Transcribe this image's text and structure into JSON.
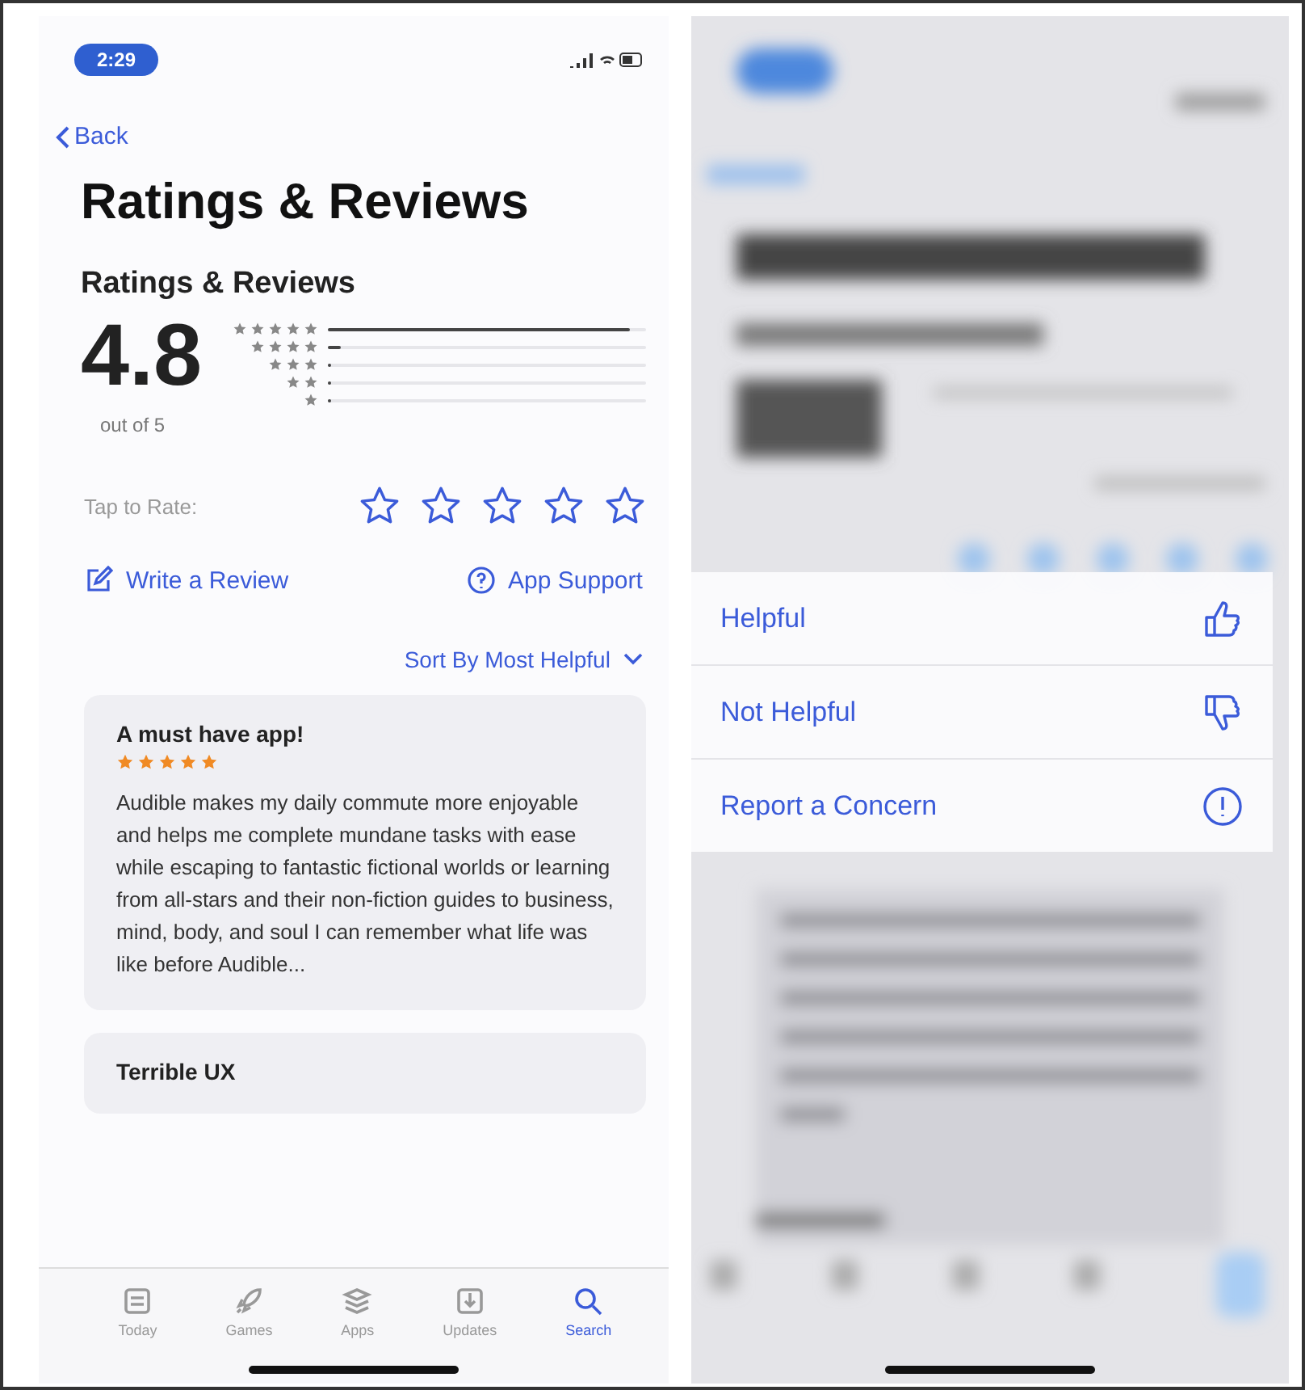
{
  "left_screen": {
    "status_bar": {
      "time": "2:29"
    },
    "back": "Back",
    "title": "Ratings & Reviews",
    "section_title": "Ratings & Reviews",
    "rating": "4.8",
    "rating_caption": "out of 5",
    "histogram": [
      {
        "level": 0.95
      },
      {
        "level": 0.04
      },
      {
        "level": 0.01
      },
      {
        "level": 0.01
      },
      {
        "level": 0.01
      }
    ],
    "tap_to_rate": {
      "label": "Tap to Rate:",
      "stars": 0
    },
    "actions": [
      {
        "kind": "write",
        "label": "Write a Review"
      },
      {
        "kind": "support",
        "label": "App Support"
      }
    ],
    "sort": "Sort By Most Helpful",
    "reviews": [
      {
        "title": "A must have app!",
        "stars": 5,
        "body": "Audible makes my daily commute more enjoyable and helps me complete mundane tasks with ease while escaping to fantastic fictional worlds or learning from all-stars and their non-fiction guides to business, mind, body, and soul I can remember what life was like before Audible..."
      },
      {
        "title": "Terrible UX"
      }
    ],
    "tabs": [
      {
        "kind": "today",
        "label": "Today",
        "selected": false
      },
      {
        "kind": "games",
        "label": "Games",
        "selected": false
      },
      {
        "kind": "apps",
        "label": "Apps",
        "selected": false
      },
      {
        "kind": "updates",
        "label": "Updates",
        "selected": false
      },
      {
        "kind": "search",
        "label": "Search",
        "selected": true
      }
    ]
  },
  "right_screen": {
    "menu": [
      {
        "kind": "helpful",
        "label": "Helpful"
      },
      {
        "kind": "not_helpful",
        "label": "Not Helpful"
      },
      {
        "kind": "report",
        "label": "Report a Concern"
      }
    ]
  }
}
